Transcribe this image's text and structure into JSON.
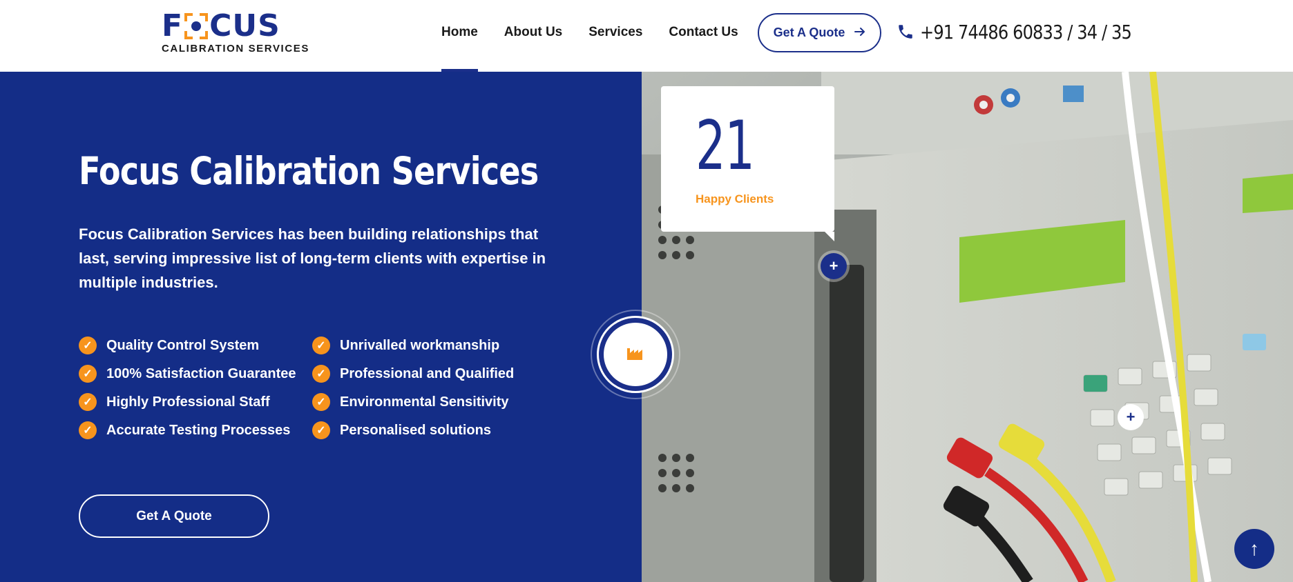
{
  "brand": {
    "logo_letter_f": "F",
    "logo_letters_cus": "CUS",
    "logo_subtitle": "CALIBRATION SERVICES",
    "primary_color": "#1b2f8a",
    "accent_color": "#f7941d",
    "hero_bg_color": "#142d87"
  },
  "nav": {
    "items": [
      {
        "label": "Home",
        "active": true
      },
      {
        "label": "About Us",
        "active": false
      },
      {
        "label": "Services",
        "active": false
      },
      {
        "label": "Contact Us",
        "active": false
      }
    ],
    "quote_button": "Get A Quote",
    "quote_button_icon": "arrow-right-icon",
    "phone_icon": "phone-icon",
    "phone": "+91 74486 60833 / 34 / 35"
  },
  "hero": {
    "title": "Focus Calibration Services",
    "description": "Focus Calibration Services has been building relationships that last, serving impressive list of long-term clients with expertise in multiple industries.",
    "features": [
      "Quality Control System",
      "Unrivalled workmanship",
      "100% Satisfaction Guarantee",
      "Professional and Qualified",
      "Highly Professional Staff",
      "Environmental Sensitivity",
      "Accurate Testing Processes",
      "Personalised solutions"
    ],
    "feature_icon": "check-circle-icon",
    "cta_button": "Get A Quote",
    "badge_icon": "factory-icon"
  },
  "stats": {
    "number": "21",
    "label": "Happy Clients"
  },
  "hotspots": {
    "plus_symbol": "+"
  },
  "scroll_top": {
    "icon": "arrow-up-icon",
    "symbol": "↑"
  }
}
